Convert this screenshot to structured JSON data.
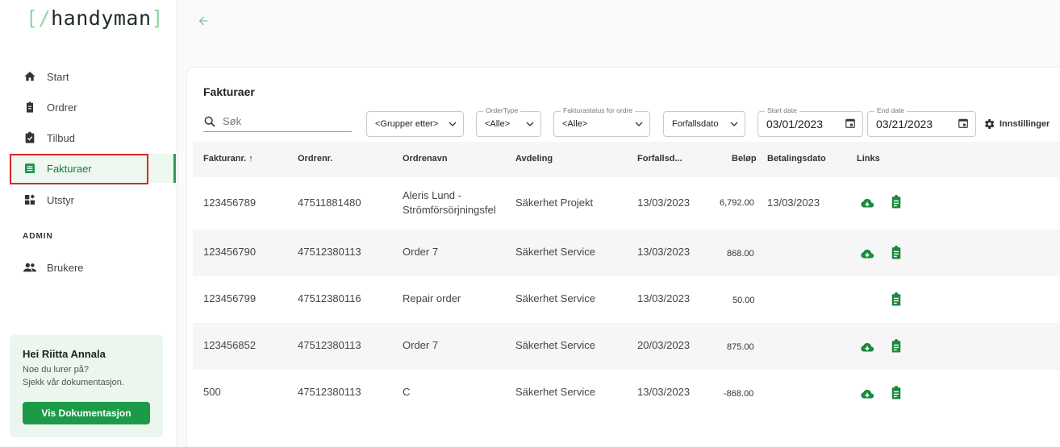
{
  "logo": {
    "open": "[",
    "slash": "/",
    "name": "handyman",
    "close": "]"
  },
  "nav": [
    {
      "label": "Start",
      "icon": "home-icon"
    },
    {
      "label": "Ordrer",
      "icon": "clipboard-icon"
    },
    {
      "label": "Tilbud",
      "icon": "clipboard-check-icon"
    },
    {
      "label": "Fakturaer",
      "icon": "list-icon"
    },
    {
      "label": "Utstyr",
      "icon": "dashboard-icon"
    }
  ],
  "admin_label": "ADMIN",
  "admin_nav": [
    {
      "label": "Brukere",
      "icon": "users-icon"
    }
  ],
  "help": {
    "greeting": "Hei Riitta Annala",
    "line1": "Noe du lurer på?",
    "line2": "Sjekk vår dokumentasjon.",
    "button": "Vis Dokumentasjon"
  },
  "page": {
    "title": "Fakturaer",
    "search_placeholder": "Søk",
    "filters": {
      "group_by": "<Grupper etter>",
      "order_type_label": "OrderType",
      "order_type_value": "<Alle>",
      "status_label": "Fakturastatus for ordre",
      "status_value": "<Alle>",
      "date_field": "Forfallsdato",
      "start_label": "Start date",
      "start_value": "03/01/2023",
      "end_label": "End date",
      "end_value": "03/21/2023"
    },
    "settings_label": "Innstillinger"
  },
  "table": {
    "columns": {
      "invoice": "Fakturanr. ↑",
      "order": "Ordrenr.",
      "name": "Ordrenavn",
      "dept": "Avdeling",
      "due": "Forfallsd...",
      "amount": "Beløp",
      "paydate": "Betalingsdato",
      "links": "Links"
    },
    "rows": [
      {
        "invoice": "123456789",
        "order": "47511881480",
        "name": "Aleris Lund - Strömförsörjningsfel",
        "dept": "Säkerhet Projekt",
        "due": "13/03/2023",
        "amount": "6,792.00",
        "paydate": "13/03/2023",
        "download": true,
        "doc": true
      },
      {
        "invoice": "123456790",
        "order": "47512380113",
        "name": "Order 7",
        "dept": "Säkerhet Service",
        "due": "13/03/2023",
        "amount": "868.00",
        "paydate": "",
        "download": true,
        "doc": true
      },
      {
        "invoice": "123456799",
        "order": "47512380116",
        "name": "Repair order",
        "dept": "Säkerhet Service",
        "due": "13/03/2023",
        "amount": "50.00",
        "paydate": "",
        "download": false,
        "doc": true
      },
      {
        "invoice": "123456852",
        "order": "47512380113",
        "name": "Order 7",
        "dept": "Säkerhet Service",
        "due": "20/03/2023",
        "amount": "875.00",
        "paydate": "",
        "download": true,
        "doc": true
      },
      {
        "invoice": "500",
        "order": "47512380113",
        "name": "C",
        "dept": "Säkerhet Service",
        "due": "13/03/2023",
        "amount": "-868.00",
        "paydate": "",
        "download": true,
        "doc": true
      }
    ]
  },
  "colors": {
    "accent": "#1d9a48",
    "active_bg": "#eef8f1",
    "focus": "#d9262c"
  }
}
